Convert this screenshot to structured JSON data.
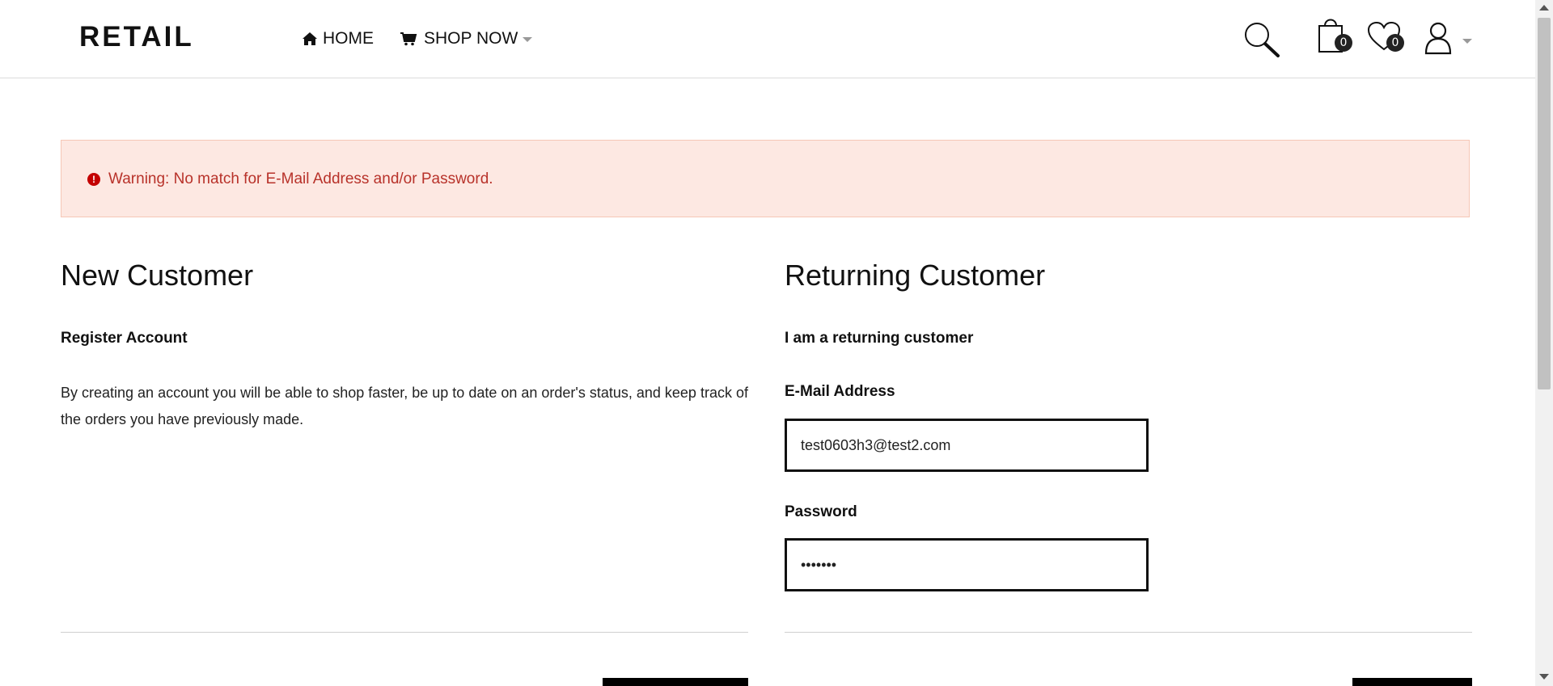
{
  "header": {
    "logo": "RETAIL",
    "nav": {
      "home_label": "HOME",
      "shop_label": "SHOP NOW"
    },
    "cart_count": "0",
    "wishlist_count": "0"
  },
  "alert": {
    "text": "Warning: No match for E-Mail Address and/or Password.",
    "icon_glyph": "!"
  },
  "new_customer": {
    "title": "New Customer",
    "subtitle": "Register Account",
    "text": "By creating an account you will be able to shop faster, be up to date on an order's status, and keep track of the orders you have previously made."
  },
  "returning_customer": {
    "title": "Returning Customer",
    "subtitle": "I am a returning customer",
    "email_label": "E-Mail Address",
    "email_value": "test0603h3@test2.com",
    "password_label": "Password",
    "password_value": "•••••••"
  },
  "colors": {
    "alert_bg": "#fde8e2",
    "alert_text": "#b8322a",
    "accent": "#000000"
  }
}
